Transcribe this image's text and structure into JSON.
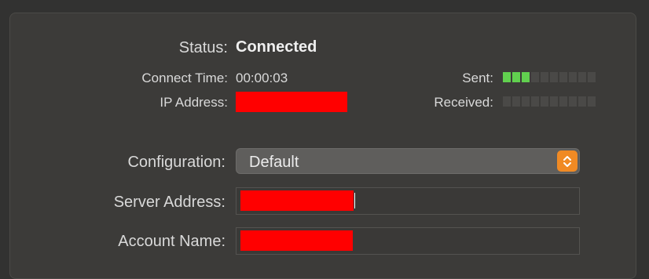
{
  "status": {
    "label": "Status:",
    "value": "Connected"
  },
  "connect_time": {
    "label": "Connect Time:",
    "value": "00:00:03"
  },
  "ip_address": {
    "label": "IP Address:",
    "value": ""
  },
  "sent": {
    "label": "Sent:",
    "level_segments": 3,
    "total_segments": 10
  },
  "received": {
    "label": "Received:",
    "level_segments": 0,
    "total_segments": 10
  },
  "configuration": {
    "label": "Configuration:",
    "selected": "Default"
  },
  "server_address": {
    "label": "Server Address:",
    "value": ""
  },
  "account_name": {
    "label": "Account Name:",
    "value": ""
  },
  "colors": {
    "meter_on": "#61d04f",
    "meter_off": "#4a4947",
    "accent": "#f08a24",
    "redaction": "#ff0000"
  }
}
